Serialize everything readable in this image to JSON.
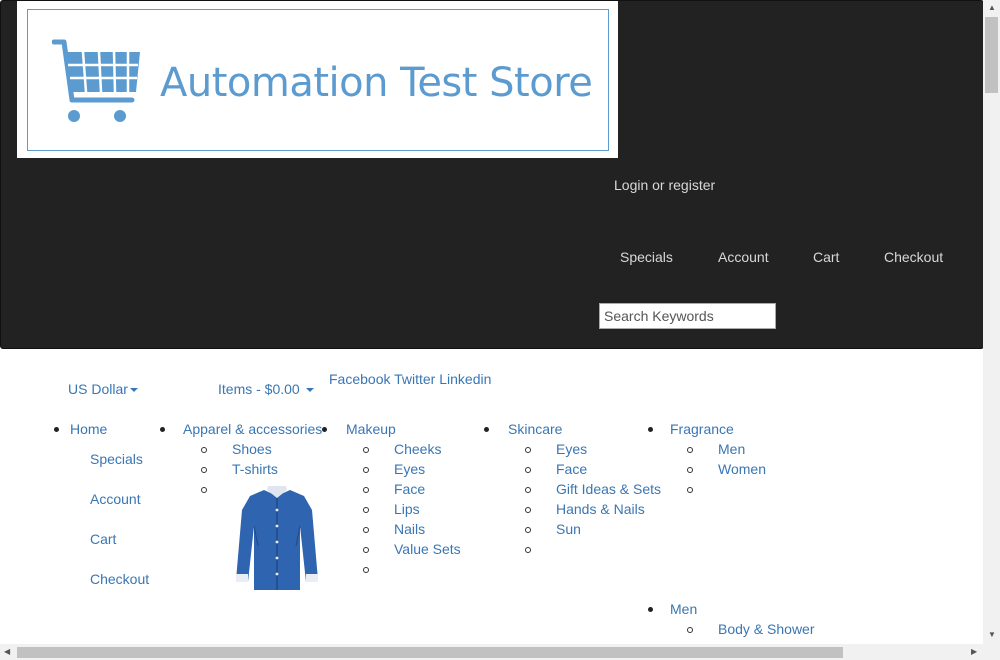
{
  "logo": {
    "text": "Automation Test Store"
  },
  "header": {
    "login": "Login or register",
    "topnav": [
      "Specials",
      "Account",
      "Cart",
      "Checkout"
    ],
    "search": {
      "placeholder": "Search Keywords",
      "value": ""
    }
  },
  "bar": {
    "currency": "US Dollar",
    "cart_glyph": "",
    "items": "Items - $0.00",
    "social": "Facebook Twitter Linkedin"
  },
  "menu": {
    "home": "Home",
    "home_sub": [
      "Specials",
      "Account",
      "Cart",
      "Checkout"
    ],
    "apparel": "Apparel & accessories",
    "apparel_sub": [
      "Shoes",
      "T-shirts"
    ],
    "makeup": "Makeup",
    "makeup_sub": [
      "Cheeks",
      "Eyes",
      "Face",
      "Lips",
      "Nails",
      "Value Sets"
    ],
    "skincare": "Skincare",
    "skincare_sub": [
      "Eyes",
      "Face",
      "Gift Ideas & Sets",
      "Hands & Nails",
      "Sun"
    ],
    "fragrance": "Fragrance",
    "fragrance_sub": [
      "Men",
      "Women"
    ],
    "men": "Men",
    "men_sub": [
      "Body & Shower"
    ]
  },
  "icon_glyph": ""
}
